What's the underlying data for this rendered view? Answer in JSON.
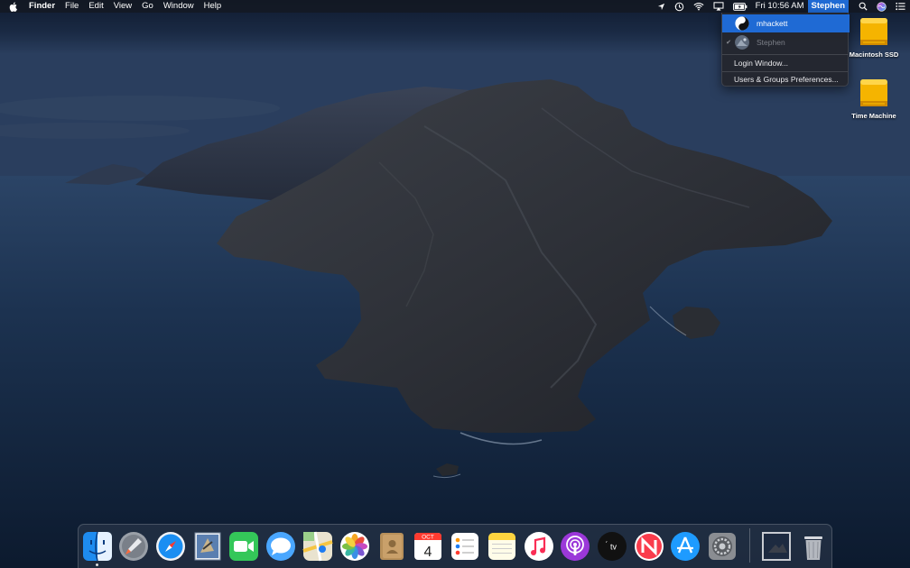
{
  "menubar": {
    "app_name": "Finder",
    "menus": [
      "File",
      "Edit",
      "View",
      "Go",
      "Window",
      "Help"
    ],
    "clock": "Fri 10:56 AM",
    "current_user": "Stephen",
    "status_icons": [
      "location-icon",
      "time-machine-icon",
      "wifi-icon",
      "airplay-icon",
      "battery-icon",
      "search-icon",
      "siri-icon",
      "notification-center-icon"
    ]
  },
  "user_switcher": {
    "users": [
      {
        "name": "mhackett",
        "selected": true,
        "logged_in": false
      },
      {
        "name": "Stephen",
        "selected": false,
        "logged_in": true
      }
    ],
    "login_window": "Login Window...",
    "users_groups_prefs": "Users & Groups Preferences..."
  },
  "desktop": {
    "icons": [
      {
        "label": "Macintosh SSD",
        "icon": "hard-drive-icon"
      },
      {
        "label": "Time Machine",
        "icon": "hard-drive-icon"
      }
    ]
  },
  "dock": {
    "apps": [
      "Finder",
      "Launchpad",
      "Safari",
      "Mail",
      "FaceTime",
      "Messages",
      "Maps",
      "Photos",
      "Contacts",
      "Calendar",
      "Reminders",
      "Notes",
      "Music",
      "Podcasts",
      "TV",
      "News",
      "App Store",
      "System Preferences"
    ],
    "running": [
      "Finder"
    ],
    "calendar": {
      "month": "OCT",
      "day": "4"
    },
    "tv_label": "tv",
    "extras": [
      "Desktop",
      "Trash"
    ]
  },
  "colors": {
    "accent": "#1f6ad4",
    "menubar": "#14182299",
    "ocean": "#1c3250"
  }
}
